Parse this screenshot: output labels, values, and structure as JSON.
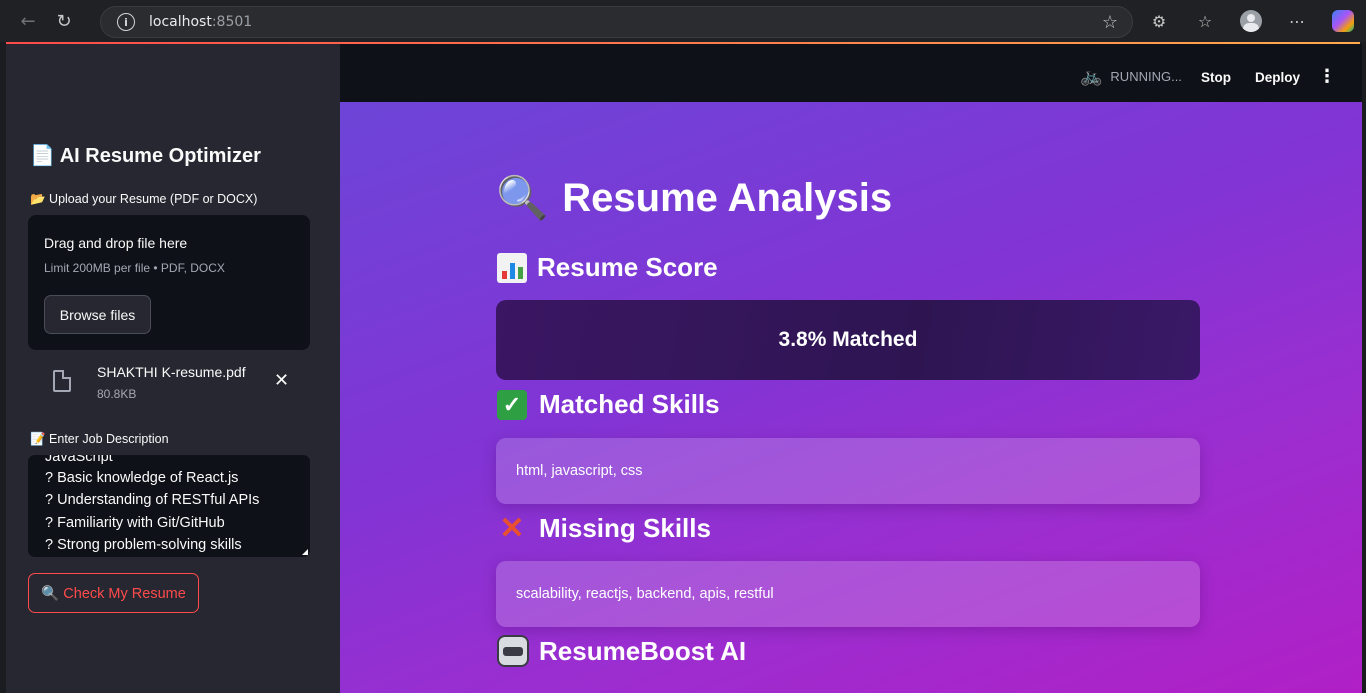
{
  "browser": {
    "url_host": "localhost",
    "url_port": ":8501"
  },
  "sidebar": {
    "title": "📄 AI Resume Optimizer",
    "upload_label": "📂 Upload your Resume (PDF or DOCX)",
    "dropzone_title": "Drag and drop file here",
    "dropzone_limit": "Limit 200MB per file • PDF, DOCX",
    "browse_label": "Browse files",
    "file_name": "SHAKTHI K-resume.pdf",
    "file_size": "80.8KB",
    "jd_label": "📝 Enter Job Description",
    "jd_lines": [
      "JavaScript",
      "? Basic knowledge of React.js",
      "? Understanding of RESTful APIs",
      "? Familiarity with Git/GitHub",
      "? Strong problem-solving skills"
    ],
    "check_button": "🔍 Check My Resume"
  },
  "topbar": {
    "status": "RUNNING...",
    "stop": "Stop",
    "deploy": "Deploy"
  },
  "main": {
    "title": "Resume Analysis",
    "score_heading": "Resume Score",
    "score_text": "3.8% Matched",
    "matched_heading": "Matched Skills",
    "matched_text": "html, javascript, css",
    "missing_heading": "Missing Skills",
    "missing_text": "scalability, reactjs, backend, apis, restful",
    "boost_heading": "ResumeBoost AI"
  },
  "colors": {
    "accent": "#ff4b4b",
    "sidebar_bg": "#262730",
    "app_dark": "#0e1117"
  },
  "icons": [
    "back-icon",
    "reload-icon",
    "info-icon",
    "star-icon",
    "extensions-icon",
    "favorites-icon",
    "profile-icon",
    "more-icon",
    "copilot-icon",
    "file-icon",
    "close-icon",
    "bike-icon",
    "kebab-icon",
    "magnifier-icon",
    "bar-chart-icon",
    "check-icon",
    "cross-icon",
    "robot-icon"
  ]
}
